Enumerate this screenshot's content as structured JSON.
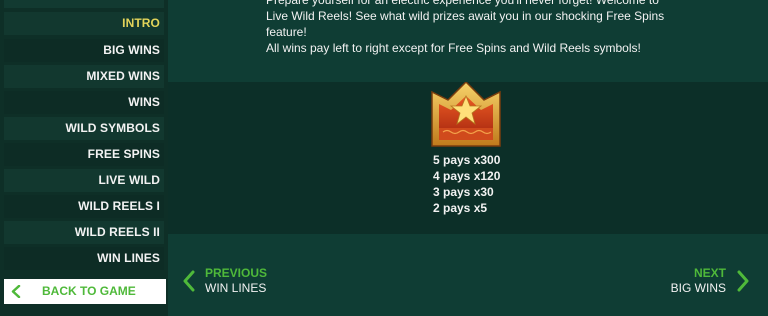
{
  "sidebar": {
    "items": [
      {
        "label": "INTRO",
        "active": true
      },
      {
        "label": "BIG WINS",
        "active": false
      },
      {
        "label": "MIXED WINS",
        "active": false
      },
      {
        "label": "WINS",
        "active": false
      },
      {
        "label": "WILD SYMBOLS",
        "active": false
      },
      {
        "label": "FREE SPINS",
        "active": false
      },
      {
        "label": "LIVE WILD",
        "active": false
      },
      {
        "label": "WILD REELS I",
        "active": false
      },
      {
        "label": "WILD REELS II",
        "active": false
      },
      {
        "label": "WIN LINES",
        "active": false
      }
    ],
    "back_label": "BACK TO GAME"
  },
  "intro": {
    "line1": "Prepare yourself for an electric experience you'll never forget! Welcome to",
    "line2": "Live Wild Reels! See what wild prizes await you in our shocking Free Spins",
    "line3": "feature!",
    "line4": "All wins pay left to right except for Free Spins and Wild Reels symbols!"
  },
  "symbol": {
    "icon": "crown-icon",
    "pays": [
      "5 pays x300",
      "4 pays x120",
      "3 pays x30",
      "2 pays x5"
    ]
  },
  "nav": {
    "prev_title": "PREVIOUS",
    "prev_sub": "WIN LINES",
    "next_title": "NEXT",
    "next_sub": "BIG WINS"
  },
  "colors": {
    "accent_green": "#4fb93a",
    "active_yellow": "#e3d45a",
    "background": "#0f3d34"
  }
}
